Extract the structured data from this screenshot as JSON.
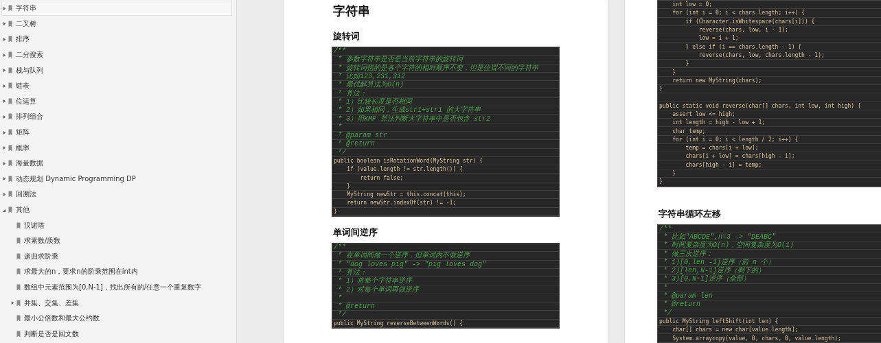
{
  "sidebar": {
    "items": [
      {
        "label": "字符串",
        "selected": true,
        "expanded": false
      },
      {
        "label": "二叉树",
        "selected": false,
        "expanded": false
      },
      {
        "label": "排序",
        "selected": false,
        "expanded": false
      },
      {
        "label": "二分搜索",
        "selected": false,
        "expanded": false
      },
      {
        "label": "栈与队列",
        "selected": false,
        "expanded": false
      },
      {
        "label": "链表",
        "selected": false,
        "expanded": false
      },
      {
        "label": "位运算",
        "selected": false,
        "expanded": false
      },
      {
        "label": "排列组合",
        "selected": false,
        "expanded": false
      },
      {
        "label": "矩阵",
        "selected": false,
        "expanded": false
      },
      {
        "label": "概率",
        "selected": false,
        "expanded": false
      },
      {
        "label": "海量数据",
        "selected": false,
        "expanded": false
      },
      {
        "label": "动态规划 Dynamic Programming DP",
        "selected": false,
        "expanded": false
      },
      {
        "label": "回溯法",
        "selected": false,
        "expanded": false
      },
      {
        "label": "其他",
        "selected": false,
        "expanded": true,
        "children": [
          {
            "label": "汉诺塔",
            "selected": false
          },
          {
            "label": "求素数/质数",
            "selected": false
          },
          {
            "label": "递归求阶乘",
            "selected": false
          },
          {
            "label": "求最大的n，要求n的阶乘范围在int内",
            "selected": false
          },
          {
            "label": "数组中元素范围为[0,N-1]，找出所有的/任意一个重复数字",
            "selected": false
          },
          {
            "label": "并集、交集、差集",
            "selected": false,
            "expanded": false
          },
          {
            "label": "最小公倍数和最大公约数",
            "selected": false
          },
          {
            "label": "判断是否是回文数",
            "selected": false
          }
        ]
      }
    ]
  },
  "pages": [
    {
      "blocks": [
        {
          "kind": "title",
          "text": "字符串"
        },
        {
          "kind": "heading",
          "text": "旋转词"
        },
        {
          "kind": "code",
          "lines": [
            {
              "kind": "comment",
              "text": "/**"
            },
            {
              "kind": "comment",
              "text": " * 参数字符串是否是当前字符串的旋转词"
            },
            {
              "kind": "comment",
              "text": " * 旋转词指的是各个字符的相对顺序不变，但是位置不同的字符串"
            },
            {
              "kind": "comment",
              "text": " * 比如123,231,312"
            },
            {
              "kind": "comment",
              "text": " * 最优解算法为O(n)"
            },
            {
              "kind": "comment",
              "text": " * 算法："
            },
            {
              "kind": "comment",
              "text": " * 1）比较长度是否相同"
            },
            {
              "kind": "comment",
              "text": " * 2）如果相同，生成str1+str1 的大字符串"
            },
            {
              "kind": "comment",
              "text": " * 3）用KMP 算法判断大字符串中是否包含 str2"
            },
            {
              "kind": "comment",
              "text": " *"
            },
            {
              "kind": "comment",
              "text": " * @param str"
            },
            {
              "kind": "comment",
              "text": " * @return"
            },
            {
              "kind": "comment",
              "text": " */"
            },
            {
              "kind": "code",
              "text": "public boolean isRotationWord(MyString str) {"
            },
            {
              "kind": "code",
              "text": "    if (value.length != str.length()) {"
            },
            {
              "kind": "code",
              "text": "        return false;"
            },
            {
              "kind": "code",
              "text": "    }"
            },
            {
              "kind": "code",
              "text": "    MyString newStr = this.concat(this);"
            },
            {
              "kind": "code",
              "text": "    return newStr.indexOf(str) != -1;"
            },
            {
              "kind": "code",
              "text": "}"
            }
          ]
        },
        {
          "kind": "heading",
          "text": "单词间逆序"
        },
        {
          "kind": "code",
          "lines": [
            {
              "kind": "comment",
              "text": "/**"
            },
            {
              "kind": "comment",
              "text": " * 在单词间做一个逆序，但单词内不做逆序"
            },
            {
              "kind": "comment",
              "text": " * \"dog loves pig\" -> \"pig loves dog\""
            },
            {
              "kind": "comment",
              "text": " * 算法："
            },
            {
              "kind": "comment",
              "text": " * 1）将整个字符串逆序"
            },
            {
              "kind": "comment",
              "text": " * 2）对每个单词再做逆序"
            },
            {
              "kind": "comment",
              "text": " *"
            },
            {
              "kind": "comment",
              "text": " * @return"
            },
            {
              "kind": "comment",
              "text": " */"
            },
            {
              "kind": "code",
              "text": "public MyString reverseBetweenWords() {"
            }
          ]
        }
      ]
    },
    {
      "blocks": [
        {
          "kind": "code",
          "lines": [
            {
              "kind": "code",
              "text": "    int low = 0;"
            },
            {
              "kind": "code",
              "text": "    for (int i = 0; i < chars.length; i++) {"
            },
            {
              "kind": "code",
              "text": "        if (Character.isWhitespace(chars[i])) {"
            },
            {
              "kind": "code",
              "text": "            reverse(chars, low, i - 1);"
            },
            {
              "kind": "code",
              "text": "            low = i + 1;"
            },
            {
              "kind": "code",
              "text": "        } else if (i == chars.length - 1) {"
            },
            {
              "kind": "code",
              "text": "            reverse(chars, low, chars.length - 1);"
            },
            {
              "kind": "code",
              "text": "        }"
            },
            {
              "kind": "code",
              "text": "    }"
            },
            {
              "kind": "code",
              "text": "    return new MyString(chars);"
            },
            {
              "kind": "code",
              "text": "}"
            },
            {
              "kind": "blank"
            },
            {
              "kind": "code",
              "text": "public static void reverse(char[] chars, int low, int high) {"
            },
            {
              "kind": "code",
              "text": "    assert low <= high;"
            },
            {
              "kind": "code",
              "text": "    int length = high - low + 1;"
            },
            {
              "kind": "code",
              "text": "    char temp;"
            },
            {
              "kind": "code",
              "text": "    for (int i = 0; i < length / 2; i++) {"
            },
            {
              "kind": "code",
              "text": "        temp = chars[i + low];"
            },
            {
              "kind": "code",
              "text": "        chars[i + low] = chars[high - i];"
            },
            {
              "kind": "code",
              "text": "        chars[high - i] = temp;"
            },
            {
              "kind": "code",
              "text": "    }"
            },
            {
              "kind": "code",
              "text": "}"
            }
          ]
        },
        {
          "kind": "heading",
          "text": "字符串循环左移"
        },
        {
          "kind": "code",
          "lines": [
            {
              "kind": "comment",
              "text": "/**"
            },
            {
              "kind": "comment",
              "text": " * 比如\"ABCDE\",n=3 -> \"DEABC\""
            },
            {
              "kind": "comment",
              "text": " * 时间复杂度为O(n)，空间复杂度为O(1)"
            },
            {
              "kind": "comment",
              "text": " * 做三次逆序："
            },
            {
              "kind": "comment",
              "text": " * 1)[0,len -1]逆序（前 n 个）"
            },
            {
              "kind": "comment",
              "text": " * 2)[len,N-1]逆序（剩下的）"
            },
            {
              "kind": "comment",
              "text": " * 3)[0,N-1]逆序（全部）"
            },
            {
              "kind": "comment",
              "text": " *"
            },
            {
              "kind": "comment",
              "text": " * @param len"
            },
            {
              "kind": "comment",
              "text": " * @return"
            },
            {
              "kind": "comment",
              "text": " */"
            },
            {
              "kind": "code",
              "text": "public MyString leftShift(int len) {"
            },
            {
              "kind": "code",
              "text": "    char[] chars = new char[value.length];"
            },
            {
              "kind": "code",
              "text": "    System.arraycopy(value, 0, chars, 0, value.length);"
            }
          ]
        }
      ]
    }
  ]
}
